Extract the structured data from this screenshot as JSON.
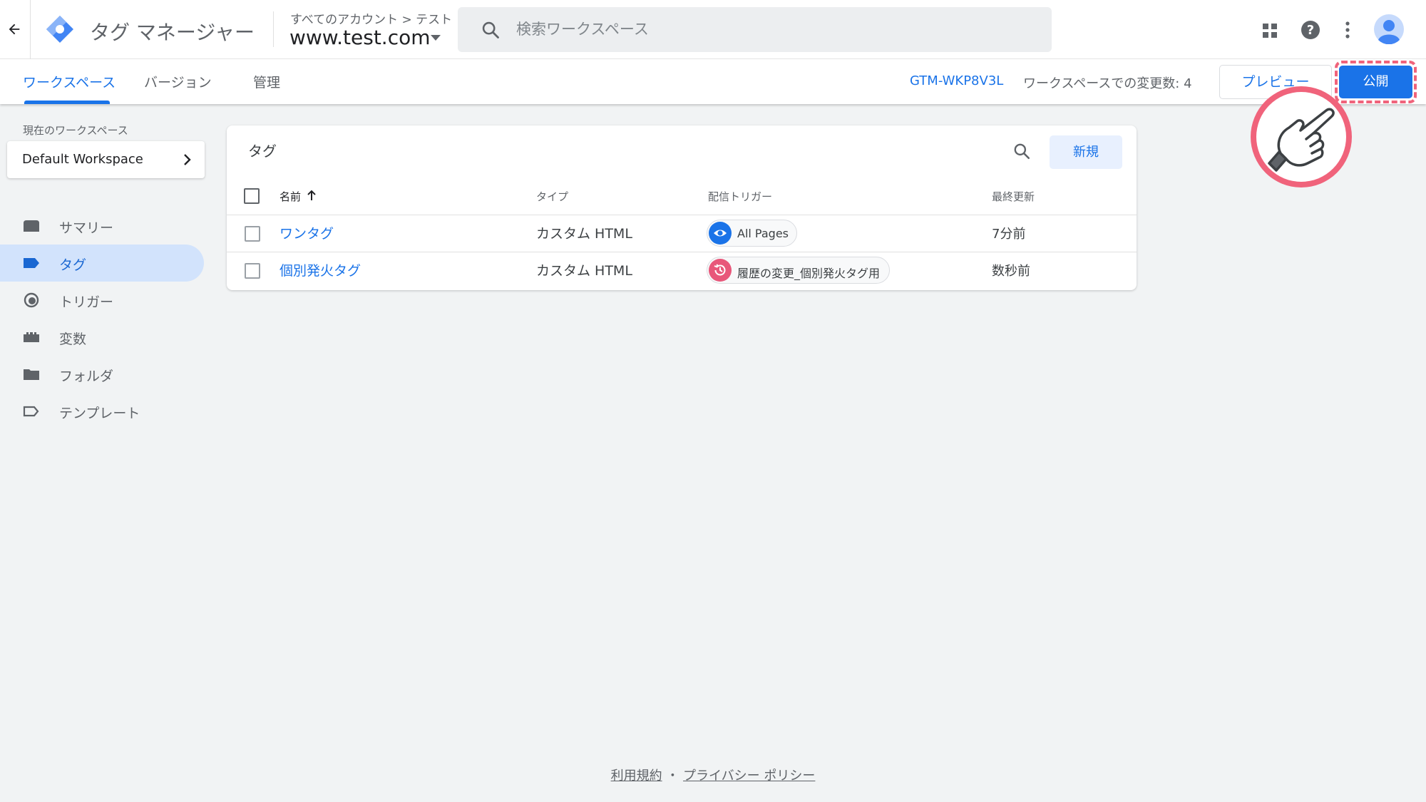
{
  "header": {
    "app_title": "タグ マネージャー",
    "breadcrumb": "すべてのアカウント > テスト",
    "container_name": "www.test.com",
    "search_placeholder": "検索ワークスペース"
  },
  "tabs": [
    {
      "label": "ワークスペース",
      "active": true
    },
    {
      "label": "バージョン",
      "active": false
    },
    {
      "label": "管理",
      "active": false
    }
  ],
  "toolbar": {
    "container_id": "GTM-WKP8V3L",
    "workspace_changes": "ワークスペースでの変更数: 4",
    "preview_label": "プレビュー",
    "publish_label": "公開"
  },
  "sidebar": {
    "workspace_label": "現在のワークスペース",
    "workspace_name": "Default Workspace",
    "items": [
      {
        "label": "サマリー",
        "icon": "summary-icon"
      },
      {
        "label": "タグ",
        "icon": "tag-icon",
        "active": true
      },
      {
        "label": "トリガー",
        "icon": "trigger-icon"
      },
      {
        "label": "変数",
        "icon": "variables-icon"
      },
      {
        "label": "フォルダ",
        "icon": "folder-icon"
      },
      {
        "label": "テンプレート",
        "icon": "template-icon"
      }
    ]
  },
  "tags_table": {
    "title": "タグ",
    "new_label": "新規",
    "columns": [
      "名前",
      "タイプ",
      "配信トリガー",
      "最終更新"
    ],
    "rows": [
      {
        "name": "ワンタグ",
        "type": "カスタム HTML",
        "trigger": "All Pages",
        "updated": "7分前"
      },
      {
        "name": "個別発火タグ",
        "type": "カスタム HTML",
        "trigger": "履歴の変更_個別発火タグ用",
        "updated": "数秒前"
      }
    ]
  },
  "footer": {
    "terms": "利用規約",
    "separator": "・",
    "privacy": "プライバシー ポリシー"
  },
  "colors": {
    "accent": "#1a73e8",
    "highlight": "#f0637b",
    "nav_active_bg": "#d2e3fc"
  }
}
